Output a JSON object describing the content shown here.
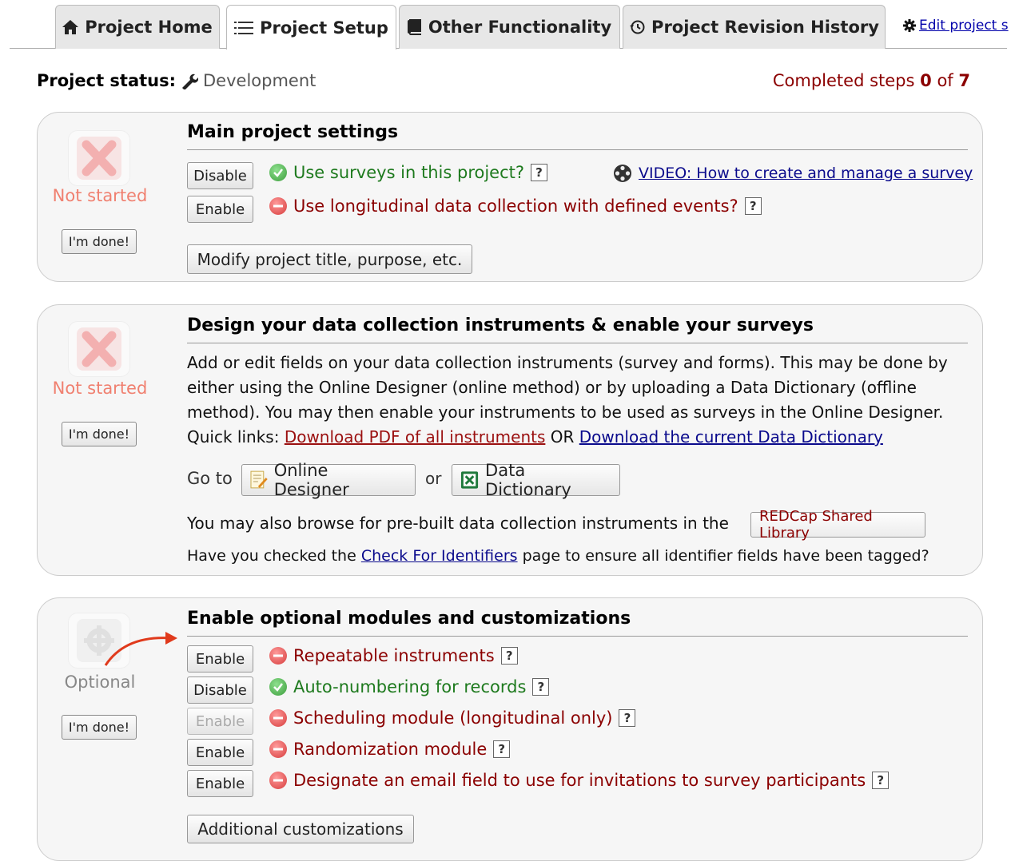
{
  "tabs": [
    {
      "label": "Project Home",
      "icon": "home-icon"
    },
    {
      "label": "Project Setup",
      "icon": "list-icon"
    },
    {
      "label": "Other Functionality",
      "icon": "book-icon"
    },
    {
      "label": "Project Revision History",
      "icon": "history-icon"
    }
  ],
  "edit_link": {
    "label": "Edit project s",
    "icon": "gear-icon"
  },
  "status": {
    "label": "Project status:",
    "value": "Development",
    "icon": "wrench-icon"
  },
  "completed": {
    "prefix": "Completed steps",
    "done": "0",
    "of": "of",
    "total": "7"
  },
  "panel1": {
    "state": "Not started",
    "done_label": "I'm done!",
    "title": "Main project settings",
    "rows": [
      {
        "button": "Disable",
        "text": "Use surveys in this project?",
        "status": "enabled"
      },
      {
        "button": "Enable",
        "text": "Use longitudinal data collection with defined events?",
        "status": "disabled"
      }
    ],
    "video_link": "VIDEO: How to create and manage a survey",
    "modify_button": "Modify project title, purpose, etc.",
    "help": "?"
  },
  "panel2": {
    "state": "Not started",
    "done_label": "I'm done!",
    "title": "Design your data collection instruments & enable your surveys",
    "desc_lines": [
      "Add or edit fields on your data collection instruments (survey and forms). This may be done by",
      "either using the Online Designer (online method) or by uploading a Data Dictionary (offline",
      "method). You may then enable your instruments to be used as surveys in the Online Designer."
    ],
    "quick_links_label": "Quick links:",
    "pdf_link": "Download PDF of all instruments",
    "or": "OR",
    "dict_link": "Download the current Data Dictionary",
    "goto": "Go to",
    "online_designer": "Online Designer",
    "or2": "or",
    "data_dictionary": "Data Dictionary",
    "browse_text": "You may also browse for pre-built data collection instruments in the",
    "library_button": "REDCap Shared Library",
    "check_prefix": "Have you checked the",
    "check_link": "Check For Identifiers",
    "check_suffix": "page to ensure all identifier fields have been tagged?"
  },
  "panel3": {
    "state": "Optional",
    "done_label": "I'm done!",
    "title": "Enable optional modules and customizations",
    "rows": [
      {
        "button": "Enable",
        "text": "Repeatable instruments",
        "status": "disabled",
        "button_disabled": false
      },
      {
        "button": "Disable",
        "text": "Auto-numbering for records",
        "status": "enabled",
        "button_disabled": false
      },
      {
        "button": "Enable",
        "text": "Scheduling module (longitudinal only)",
        "status": "disabled",
        "button_disabled": true
      },
      {
        "button": "Enable",
        "text": "Randomization module",
        "status": "disabled",
        "button_disabled": false
      },
      {
        "button": "Enable",
        "text": "Designate an email field to use for invitations to survey participants",
        "status": "disabled",
        "button_disabled": false
      }
    ],
    "custom_button": "Additional customizations",
    "help": "?"
  },
  "colors": {
    "accent_red": "#8b0000",
    "green": "#1e7a1e",
    "link": "#0a0a8c"
  }
}
